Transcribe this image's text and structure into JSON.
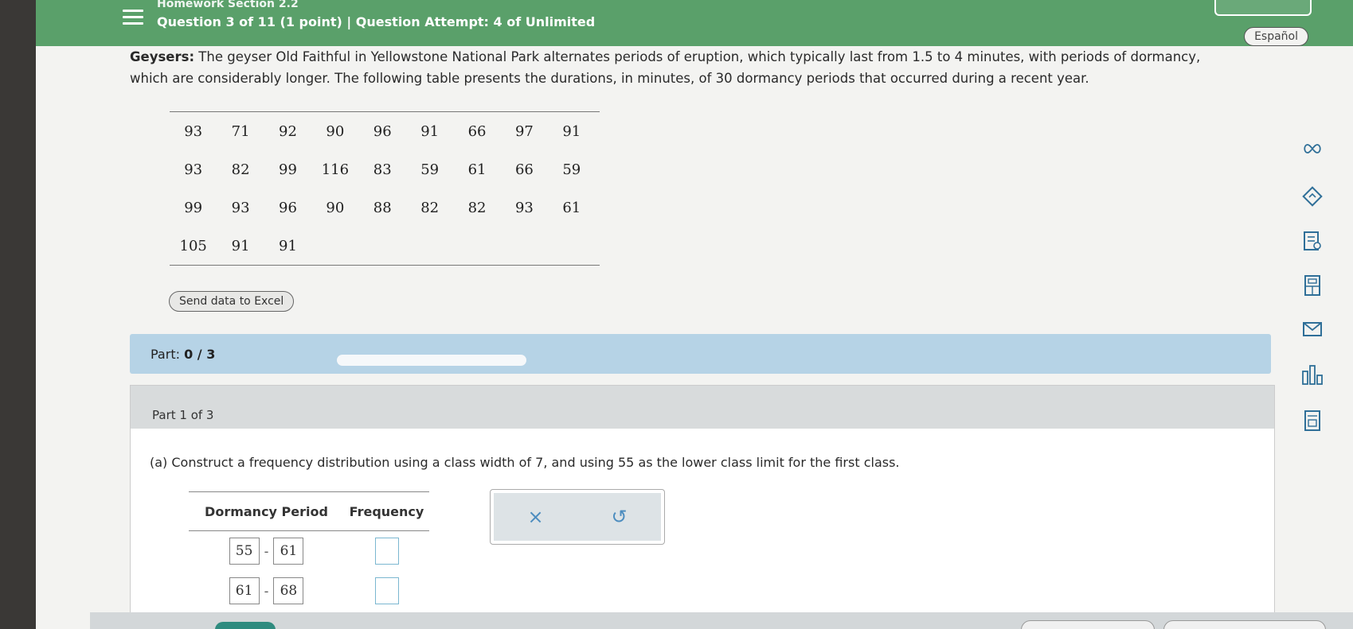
{
  "header": {
    "section": "Homework Section 2.2",
    "question_line": "Question 3 of 11 (1 point)  |  Question Attempt: 4 of Unlimited"
  },
  "language_button": "Español",
  "problem": {
    "lead": "Geysers:",
    "text": " The geyser Old Faithful in Yellowstone National Park alternates periods of eruption, which typically last from 1.5 to 4 minutes, with periods of dormancy, which are considerably longer. The following table presents the durations, in minutes, of 30 dormancy periods that occurred during a recent year."
  },
  "data_rows": [
    [
      "93",
      "71",
      "92",
      "90",
      "96",
      "91",
      "66",
      "97",
      "91"
    ],
    [
      "93",
      "82",
      "99",
      "116",
      "83",
      "59",
      "61",
      "66",
      "59"
    ],
    [
      "99",
      "93",
      "96",
      "90",
      "88",
      "82",
      "82",
      "93",
      "61"
    ],
    [
      "105",
      "91",
      "91",
      "",
      "",
      "",
      "",
      "",
      ""
    ]
  ],
  "excel_button": "Send data to Excel",
  "part_progress": {
    "label": "Part:",
    "value": "0 / 3",
    "fraction": 0
  },
  "part": {
    "title": "Part 1 of 3",
    "question": "(a) Construct a frequency distribution using a class width of 7, and using 55 as the lower class limit for the first class."
  },
  "freq_table": {
    "headers": [
      "Dormancy Period",
      "Frequency"
    ],
    "rows": [
      {
        "low": "55",
        "high": "61",
        "frequency": ""
      },
      {
        "low": "61",
        "high": "68",
        "frequency": ""
      }
    ]
  },
  "tools": {
    "clear": "×",
    "undo": "↺"
  }
}
